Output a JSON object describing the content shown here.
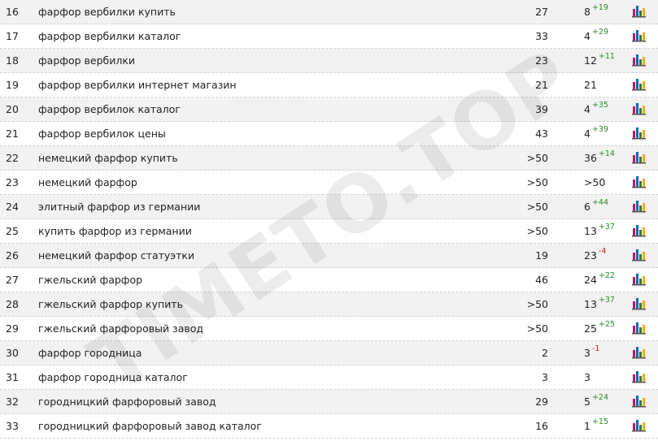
{
  "watermark": "TIMETO.TOP",
  "icon_name": "bar-chart-icon",
  "colors": {
    "delta_up": "#2b8a2b",
    "delta_down": "#d22222",
    "row_alt": "#f2f2f2"
  },
  "rows": [
    {
      "num": "16",
      "keyword": "фарфор вербилки купить",
      "pos_a": "27",
      "pos_b": "8",
      "delta": "+19",
      "dir": "up"
    },
    {
      "num": "17",
      "keyword": "фарфор вербилки каталог",
      "pos_a": "33",
      "pos_b": "4",
      "delta": "+29",
      "dir": "up"
    },
    {
      "num": "18",
      "keyword": "фарфор вербилки",
      "pos_a": "23",
      "pos_b": "12",
      "delta": "+11",
      "dir": "up"
    },
    {
      "num": "19",
      "keyword": "фарфор вербилки интернет магазин",
      "pos_a": "21",
      "pos_b": "21",
      "delta": "",
      "dir": ""
    },
    {
      "num": "20",
      "keyword": "фарфор вербилок каталог",
      "pos_a": "39",
      "pos_b": "4",
      "delta": "+35",
      "dir": "up"
    },
    {
      "num": "21",
      "keyword": "фарфор вербилок цены",
      "pos_a": "43",
      "pos_b": "4",
      "delta": "+39",
      "dir": "up"
    },
    {
      "num": "22",
      "keyword": "немецкий фарфор купить",
      "pos_a": ">50",
      "pos_b": "36",
      "delta": "+14",
      "dir": "up"
    },
    {
      "num": "23",
      "keyword": "немецкий фарфор",
      "pos_a": ">50",
      "pos_b": ">50",
      "delta": "",
      "dir": ""
    },
    {
      "num": "24",
      "keyword": "элитный фарфор из германии",
      "pos_a": ">50",
      "pos_b": "6",
      "delta": "+44",
      "dir": "up"
    },
    {
      "num": "25",
      "keyword": "купить фарфор из германии",
      "pos_a": ">50",
      "pos_b": "13",
      "delta": "+37",
      "dir": "up"
    },
    {
      "num": "26",
      "keyword": "немецкий фарфор статуэтки",
      "pos_a": "19",
      "pos_b": "23",
      "delta": "-4",
      "dir": "down"
    },
    {
      "num": "27",
      "keyword": "гжельский фарфор",
      "pos_a": "46",
      "pos_b": "24",
      "delta": "+22",
      "dir": "up"
    },
    {
      "num": "28",
      "keyword": "гжельский фарфор купить",
      "pos_a": ">50",
      "pos_b": "13",
      "delta": "+37",
      "dir": "up"
    },
    {
      "num": "29",
      "keyword": "гжельский фарфоровый завод",
      "pos_a": ">50",
      "pos_b": "25",
      "delta": "+25",
      "dir": "up"
    },
    {
      "num": "30",
      "keyword": "фарфор городница",
      "pos_a": "2",
      "pos_b": "3",
      "delta": "-1",
      "dir": "down"
    },
    {
      "num": "31",
      "keyword": "фарфор городница каталог",
      "pos_a": "3",
      "pos_b": "3",
      "delta": "",
      "dir": ""
    },
    {
      "num": "32",
      "keyword": "городницкий фарфоровый завод",
      "pos_a": "29",
      "pos_b": "5",
      "delta": "+24",
      "dir": "up"
    },
    {
      "num": "33",
      "keyword": "городницкий фарфоровый завод каталог",
      "pos_a": "16",
      "pos_b": "1",
      "delta": "+15",
      "dir": "up"
    }
  ]
}
